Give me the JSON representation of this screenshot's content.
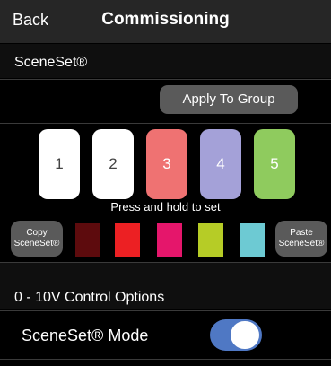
{
  "nav": {
    "back_label": "Back",
    "title": "Commissioning"
  },
  "sceneset": {
    "header": "SceneSet®",
    "apply_label": "Apply To Group",
    "scenes": [
      {
        "label": "1",
        "color": "#ffffff",
        "text_color": "#444444"
      },
      {
        "label": "2",
        "color": "#ffffff",
        "text_color": "#444444"
      },
      {
        "label": "3",
        "color": "#ef7272",
        "text_color": "#ffffff"
      },
      {
        "label": "4",
        "color": "#a4a1d8",
        "text_color": "#ffffff"
      },
      {
        "label": "5",
        "color": "#8fcb5e",
        "text_color": "#ffffff"
      }
    ],
    "press_hold": "Press and hold to set",
    "copy_label_1": "Copy",
    "copy_label_2": "SceneSet®",
    "paste_label_1": "Paste",
    "paste_label_2": "SceneSet®",
    "swatches": [
      "#5d0b0d",
      "#ec2023",
      "#e5166b",
      "#b6cc26",
      "#6dcad3"
    ]
  },
  "control": {
    "header": "0 - 10V Control Options",
    "mode_label": "SceneSet® Mode",
    "mode_on": true,
    "toggle_color": "#4f78c4"
  }
}
